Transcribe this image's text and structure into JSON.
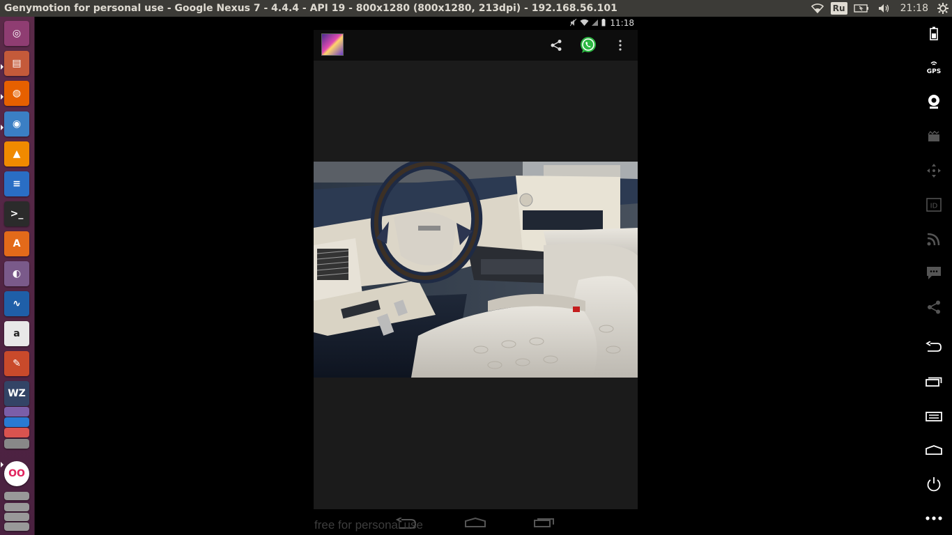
{
  "window": {
    "title": "Genymotion for personal use - Google Nexus 7 - 4.4.4 - API 19 - 800x1280 (800x1280, 213dpi) - 192.168.56.101"
  },
  "tray": {
    "keyboard": "Ru",
    "time": "21:18"
  },
  "launcher": {
    "items": [
      {
        "name": "ubuntu-dash",
        "color": "#8f3d72"
      },
      {
        "name": "files",
        "color": "#c45a3a"
      },
      {
        "name": "firefox",
        "color": "#e66000"
      },
      {
        "name": "chromium",
        "color": "#3b7fc4"
      },
      {
        "name": "vlc",
        "color": "#f08a00"
      },
      {
        "name": "writer",
        "color": "#2a6ec4"
      },
      {
        "name": "terminal",
        "color": "#2b2b2b"
      },
      {
        "name": "software-center",
        "color": "#e36a1a"
      },
      {
        "name": "disk-burner",
        "color": "#7a5a8a"
      },
      {
        "name": "system-monitor",
        "color": "#1f5fa8"
      },
      {
        "name": "amazon",
        "color": "#e8e8e8"
      },
      {
        "name": "settings",
        "color": "#c94a2b"
      },
      {
        "name": "wz-app",
        "color": "#334466"
      }
    ]
  },
  "device": {
    "status_time": "11:18",
    "actionbar": {
      "app_icon": "gallery-icon",
      "share": "share-icon",
      "whatsapp": "whatsapp-icon",
      "overflow": "overflow-menu-icon"
    },
    "photo": {
      "subject": "car-interior-photo"
    }
  },
  "watermark": "free for personal use",
  "right_toolbar": {
    "items": [
      {
        "name": "battery-icon",
        "dim": false
      },
      {
        "name": "gps-icon",
        "dim": false,
        "label": "GPS"
      },
      {
        "name": "webcam-icon",
        "dim": false
      },
      {
        "name": "screencast-icon",
        "dim": true
      },
      {
        "name": "dpad-icon",
        "dim": true
      },
      {
        "name": "device-id-icon",
        "dim": true,
        "label": "ID"
      },
      {
        "name": "rss-icon",
        "dim": true
      },
      {
        "name": "sms-icon",
        "dim": true
      },
      {
        "name": "share-icon",
        "dim": true
      },
      {
        "name": "back-icon",
        "dim": false
      },
      {
        "name": "recent-apps-icon",
        "dim": false
      },
      {
        "name": "menu-icon",
        "dim": false
      },
      {
        "name": "home-icon",
        "dim": false
      },
      {
        "name": "power-icon",
        "dim": false
      },
      {
        "name": "more-icon",
        "dim": false
      }
    ]
  }
}
